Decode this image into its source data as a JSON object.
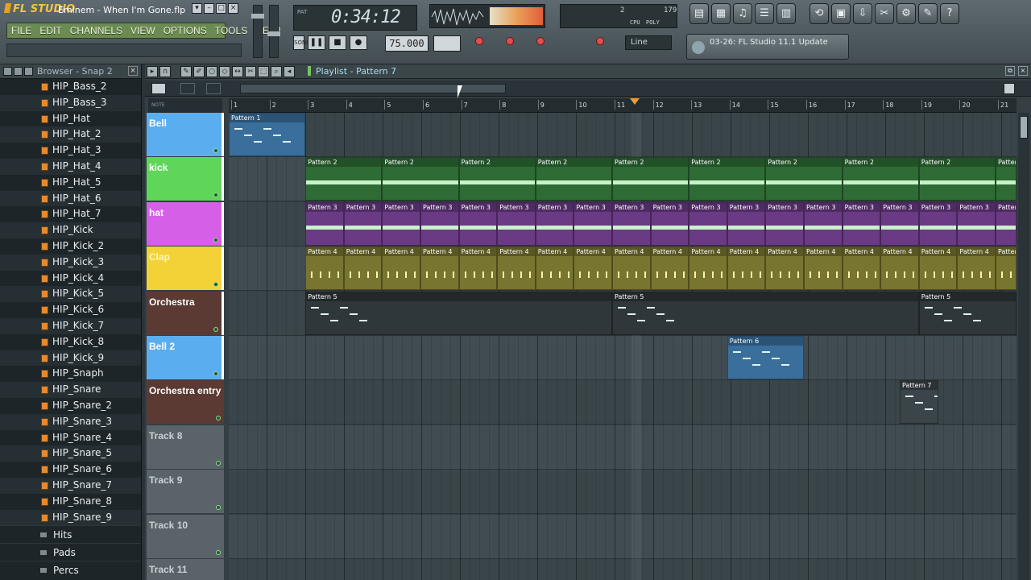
{
  "window": {
    "app_name": "FL STUDIO",
    "project_title": "Eminem - When I'm Gone.flp"
  },
  "menu": [
    "FILE",
    "EDIT",
    "CHANNELS",
    "VIEW",
    "OPTIONS",
    "TOOLS",
    "HELP"
  ],
  "transport": {
    "time": "0:34:12",
    "tempo": "75.000",
    "pat_label": "PAT",
    "song_label": "SONG",
    "play": "▶",
    "stop": "■",
    "record": "●",
    "pause": "❚❚"
  },
  "cpu": {
    "poly": "2",
    "mem": "179",
    "cpu_label": "CPU",
    "poly_label": "POLY"
  },
  "snap_mode": "Line",
  "news": "03-26: FL Studio 11.1 Update",
  "browser": {
    "title": "Browser - Snap 2",
    "items": [
      "HIP_Bass_2",
      "HIP_Bass_3",
      "HIP_Hat",
      "HIP_Hat_2",
      "HIP_Hat_3",
      "HIP_Hat_4",
      "HIP_Hat_5",
      "HIP_Hat_6",
      "HIP_Hat_7",
      "HIP_Kick",
      "HIP_Kick_2",
      "HIP_Kick_3",
      "HIP_Kick_4",
      "HIP_Kick_5",
      "HIP_Kick_6",
      "HIP_Kick_7",
      "HIP_Kick_8",
      "HIP_Kick_9",
      "HIP_Snaph",
      "HIP_Snare",
      "HIP_Snare_2",
      "HIP_Snare_3",
      "HIP_Snare_4",
      "HIP_Snare_5",
      "HIP_Snare_6",
      "HIP_Snare_7",
      "HIP_Snare_8",
      "HIP_Snare_9"
    ],
    "folders": [
      "Hits",
      "Pads",
      "Percs"
    ]
  },
  "playlist": {
    "title": "Playlist - Pattern 7",
    "snap_label": "NOTE",
    "bars": [
      "1",
      "2",
      "3",
      "4",
      "5",
      "6",
      "7",
      "8",
      "9",
      "10",
      "11",
      "12",
      "13",
      "14",
      "15",
      "16",
      "17",
      "18",
      "19",
      "20",
      "21"
    ],
    "tracks": [
      {
        "name": "Bell",
        "color": "#5aaef0"
      },
      {
        "name": "kick",
        "color": "#5fd65a"
      },
      {
        "name": "hat",
        "color": "#d65fe8"
      },
      {
        "name": "Clap",
        "color": "#f2d236"
      },
      {
        "name": "Orchestra",
        "color": "#5b3a34"
      },
      {
        "name": "Bell 2",
        "color": "#5aaef0"
      },
      {
        "name": "Orchestra entry",
        "color": "#5b3a34"
      },
      {
        "name": "Track 8",
        "color": "#5a6468"
      },
      {
        "name": "Track 9",
        "color": "#5a6468"
      },
      {
        "name": "Track 10",
        "color": "#5a6468"
      },
      {
        "name": "Track 11",
        "color": "#5a6468"
      }
    ],
    "clip_labels": {
      "p1": "Pattern 1",
      "p2": "Pattern 2",
      "p3": "Pattern 3",
      "p4": "Pattern 4",
      "p5": "Pattern 5",
      "p6": "Pattern 6",
      "p7": "Pattern 7"
    }
  }
}
